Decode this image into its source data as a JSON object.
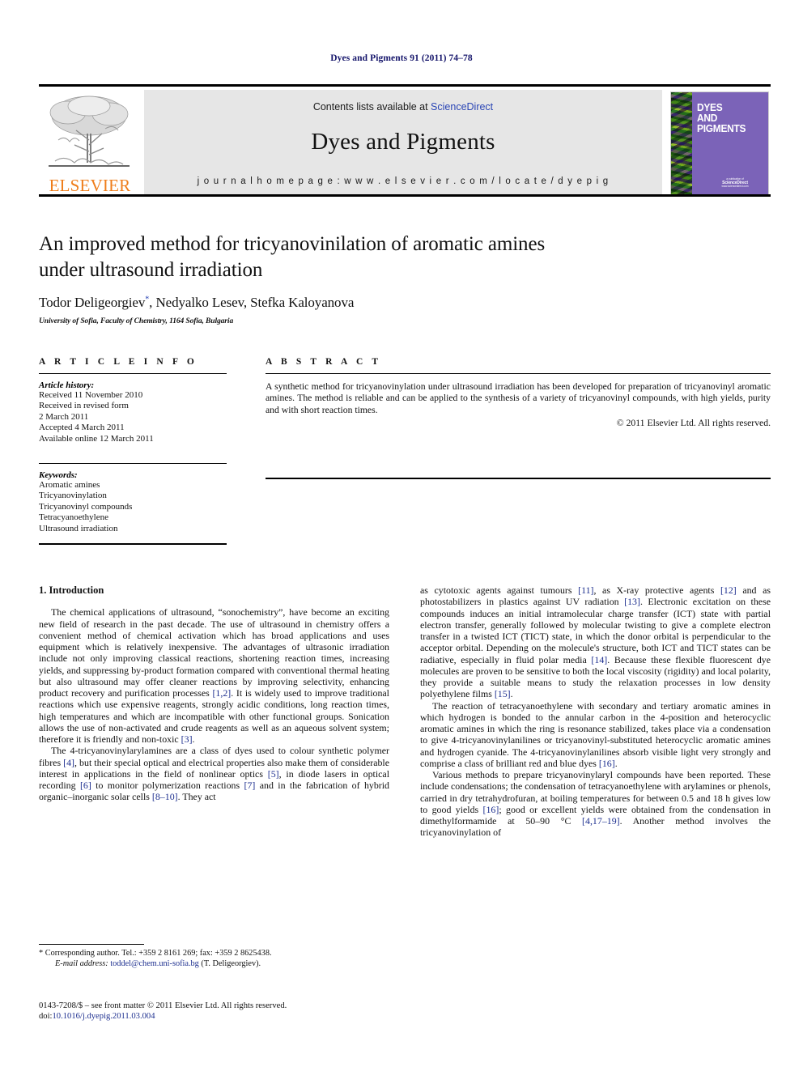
{
  "running_head": "Dyes and Pigments 91 (2011) 74–78",
  "masthead": {
    "publisher_name": "ELSEVIER",
    "contents_prefix": "Contents lists available at ",
    "contents_link": "ScienceDirect",
    "journal_name": "Dyes and Pigments",
    "homepage": "j o u r n a l   h o m e p a g e :   w w w . e l s e v i e r . c o m / l o c a t e / d y e p i g",
    "cover": {
      "line1": "Dyes",
      "line2": "and",
      "line3": "Pigments",
      "footer_small": "a publication of",
      "footer_brand": "ScienceDirect",
      "footer_url": "www.sciencedirect.com"
    }
  },
  "article": {
    "title_line1": "An improved method for tricyanovinilation of aromatic amines",
    "title_line2": "under ultrasound irradiation",
    "authors": "Todor Deligeorgiev*, Nedyalko Lesev, Stefka Kaloyanova",
    "author_star": "*",
    "affiliation": "University of Sofia, Faculty of Chemistry, 1164 Sofia, Bulgaria"
  },
  "article_info": {
    "heading": "A R T I C L E   I N F O",
    "history_label": "Article history:",
    "history": [
      "Received 11 November 2010",
      "Received in revised form",
      "2 March 2011",
      "Accepted 4 March 2011",
      "Available online 12 March 2011"
    ],
    "keywords_label": "Keywords:",
    "keywords": [
      "Aromatic amines",
      "Tricyanovinylation",
      "Tricyanovinyl compounds",
      "Tetracyanoethylene",
      "Ultrasound irradiation"
    ]
  },
  "abstract": {
    "heading": "A B S T R A C T",
    "text": "A synthetic method for tricyanovinylation under ultrasound irradiation has been developed for preparation of tricyanovinyl aromatic amines. The method is reliable and can be applied to the synthesis of a variety of tricyanovinyl compounds, with high yields, purity and with short reaction times.",
    "copyright": "© 2011 Elsevier Ltd. All rights reserved."
  },
  "body": {
    "section1_heading": "1. Introduction",
    "left_paragraphs": [
      "The chemical applications of ultrasound, “sonochemistry”, have become an exciting new field of research in the past decade. The use of ultrasound in chemistry offers a convenient method of chemical activation which has broad applications and uses equipment which is relatively inexpensive. The advantages of ultrasonic irradiation include not only improving classical reactions, shortening reaction times, increasing yields, and suppressing by-product formation compared with conventional thermal heating but also ultrasound may offer cleaner reactions by improving selectivity, enhancing product recovery and purification processes [1,2]. It is widely used to improve traditional reactions which use expensive reagents, strongly acidic conditions, long reaction times, high temperatures and which are incompatible with other functional groups. Sonication allows the use of non-activated and crude reagents as well as an aqueous solvent system; therefore it is friendly and non-toxic [3].",
      "The 4-tricyanovinylarylamines are a class of dyes used to colour synthetic polymer fibres [4], but their special optical and electrical properties also make them of considerable interest in applications in the field of nonlinear optics [5], in diode lasers in optical recording [6] to monitor polymerization reactions [7] and in the fabrication of hybrid organic–inorganic solar cells [8–10]. They act"
    ],
    "right_paragraphs": [
      "as cytotoxic agents against tumours [11], as X-ray protective agents [12] and as photostabilizers in plastics against UV radiation [13]. Electronic excitation on these compounds induces an initial intramolecular charge transfer (ICT) state with partial electron transfer, generally followed by molecular twisting to give a complete electron transfer in a twisted ICT (TICT) state, in which the donor orbital is perpendicular to the acceptor orbital. Depending on the molecule's structure, both ICT and TICT states can be radiative, especially in fluid polar media [14]. Because these flexible fluorescent dye molecules are proven to be sensitive to both the local viscosity (rigidity) and local polarity, they provide a suitable means to study the relaxation processes in low density polyethylene films [15].",
      "The reaction of tetracyanoethylene with secondary and tertiary aromatic amines in which hydrogen is bonded to the annular carbon in the 4-position and heterocyclic aromatic amines in which the ring is resonance stabilized, takes place via a condensation to give 4-tricyanovinylanilines or tricyanovinyl-substituted heterocyclic aromatic amines and hydrogen cyanide. The 4-tricyanovinylanilines absorb visible light very strongly and comprise a class of brilliant red and blue dyes [16].",
      "Various methods to prepare tricyanovinylaryl compounds have been reported. These include condensations; the condensation of tetracyanoethylene with arylamines or phenols, carried in dry tetrahydrofuran, at boiling temperatures for between 0.5 and 18 h gives low to good yields [16]; good or excellent yields were obtained from the condensation in dimethylformamide at 50–90 °C [4,17–19]. Another method involves the tricyanovinylation of"
    ]
  },
  "footnote": {
    "corresponding": "* Corresponding author. Tel.: +359 2 8161 269; fax: +359 2 8625438.",
    "email_label": "E-mail address:",
    "email": "toddel@chem.uni-sofia.bg",
    "email_suffix": "(T. Deligeorgiev)."
  },
  "copyright_block": {
    "line1": "0143-7208/$ – see front matter © 2011 Elsevier Ltd. All rights reserved.",
    "doi_label": "doi:",
    "doi": "10.1016/j.dyepig.2011.03.004"
  },
  "colors": {
    "running_head": "#15156b",
    "link": "#2a45b5",
    "reference": "#1d2f8f",
    "elsevier_orange": "#ef7d1a",
    "masthead_gray": "#e6e6e6",
    "cover_purple": "#7b63b8"
  }
}
